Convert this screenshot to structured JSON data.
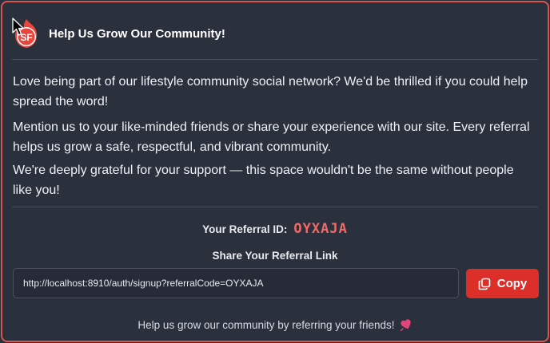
{
  "header": {
    "logo_text": "SF",
    "title": "Help Us Grow Our Community!"
  },
  "body": {
    "paragraphs": [
      "Love being part of our lifestyle community social network? We'd be thrilled if you could help spread the word!",
      "Mention us to your like-minded friends or share your experience with our site. Every referral helps us grow a safe, respectful, and vibrant community.",
      "We're deeply grateful for your support — this space wouldn't be the same without people like you!"
    ]
  },
  "referral": {
    "id_label": "Your Referral ID:",
    "id_value": "OYXAJA",
    "share_label": "Share Your Referral Link",
    "link_value": "http://localhost:8910/auth/signup?referralCode=OYXAJA",
    "copy_label": "Copy"
  },
  "footer": {
    "text": "Help us grow our community by referring your friends!",
    "icon": "heart-icon"
  },
  "colors": {
    "accent": "#dc2f2a",
    "border": "#d9534f",
    "code": "#f06a6a",
    "background": "#2b303d"
  }
}
